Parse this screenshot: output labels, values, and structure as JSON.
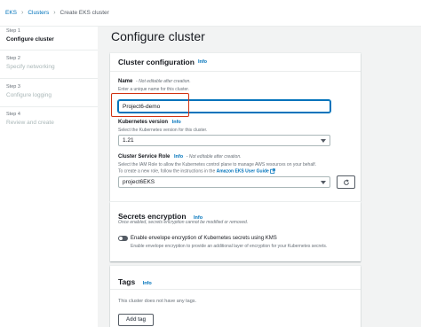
{
  "breadcrumb": {
    "items": [
      "EKS",
      "Clusters",
      "Create EKS cluster"
    ],
    "separator": "›"
  },
  "sidebar": {
    "steps": [
      {
        "number": "Step 1",
        "title": "Configure cluster",
        "active": true
      },
      {
        "number": "Step 2",
        "title": "Specify networking",
        "active": false
      },
      {
        "number": "Step 3",
        "title": "Configure logging",
        "active": false
      },
      {
        "number": "Step 4",
        "title": "Review and create",
        "active": false
      }
    ]
  },
  "main": {
    "page_title": "Configure cluster"
  },
  "cluster_config": {
    "title": "Cluster configuration",
    "info": "Info",
    "name": {
      "label": "Name",
      "note": "- Not editable after creation.",
      "description": "Enter a unique name for this cluster.",
      "value": "Project6-demo"
    },
    "k8s_version": {
      "label": "Kubernetes version",
      "info": "Info",
      "description": "Select the Kubernetes version for this cluster.",
      "value": "1.21"
    },
    "service_role": {
      "label": "Cluster Service Role",
      "info": "Info",
      "note": "- Not editable after creation.",
      "description_1": "Select the IAM Role to allow the Kubernetes control plane to manage AWS resources on your behalf.",
      "description_2": "To create a new role, follow the instructions in the",
      "guide_link": "Amazon EKS User Guide",
      "value": "project6EKS"
    }
  },
  "secrets": {
    "title": "Secrets encryption",
    "info": "Info",
    "note": "Once enabled, secrets encryption cannot be modified or removed.",
    "toggle_label": "Enable envelope encryption of Kubernetes secrets using KMS",
    "toggle_description": "Enable envelope encryption to provide an additional layer of encryption for your Kubernetes secrets.",
    "enabled": false
  },
  "tags": {
    "title": "Tags",
    "info": "Info",
    "empty_text": "This cluster does not have any tags.",
    "add_button": "Add tag"
  },
  "colors": {
    "link": "#0073bb",
    "highlight": "#d13212",
    "background": "#f2f3f3"
  }
}
